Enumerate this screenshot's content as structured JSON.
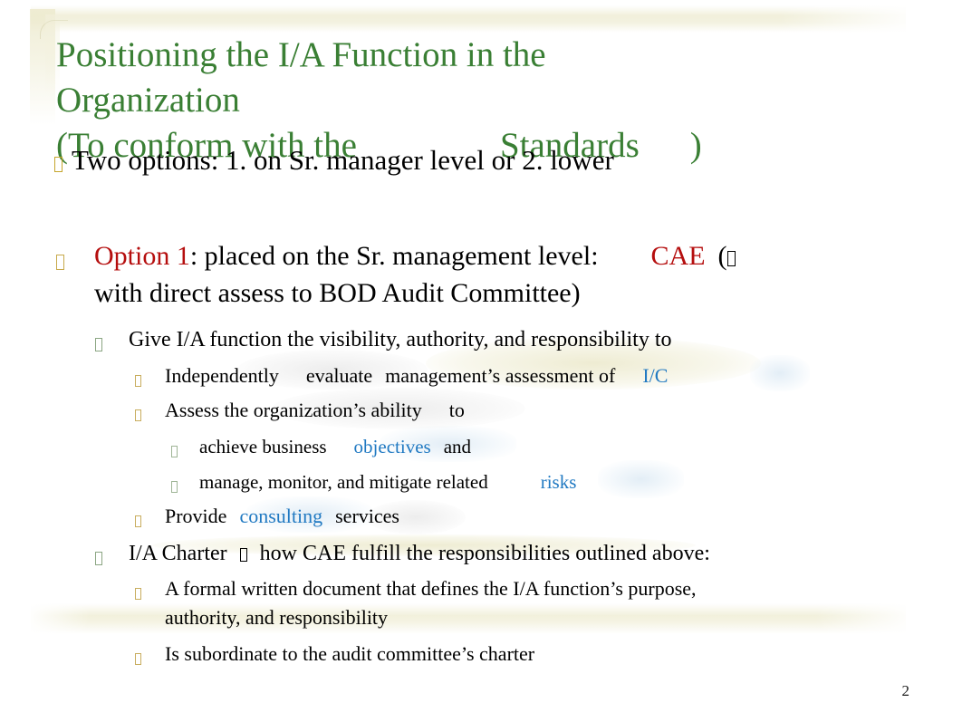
{
  "slide": {
    "page_number": "2",
    "colors": {
      "title_green": "#3a7f34",
      "accent_red": "#b50e0e",
      "accent_blue": "#2079c2",
      "band_beige": "#edeace",
      "bullet_gold": "#c7a94a",
      "bullet_green": "#8aa582"
    }
  },
  "title": {
    "line1": "Positioning the I/A Function in the",
    "line2": "Organization",
    "line3_prefix": "(To conform with the",
    "line3_standards": "Standards",
    "line3_suffix": ")"
  },
  "overlay": {
    "bullet_icon": "missing-glyph-box",
    "text": "Two options: 1. on Sr. manager level or 2. lower"
  },
  "body": {
    "option1": {
      "bullet_icon": "missing-glyph-box",
      "label": "Option 1",
      "text_a": ": placed on the Sr. management level:",
      "cae": "CAE",
      "paren_open": "(",
      "arrow_icon": "missing-glyph-box",
      "line2": "with direct assess to BOD Audit Committee)"
    },
    "give": {
      "bullet_icon": "missing-glyph-box",
      "text": "Give I/A function the visibility, authority, and responsibility to"
    },
    "independently": {
      "bullet_icon": "missing-glyph-box",
      "part1": "Independently",
      "part2": "evaluate",
      "part3": "management’s assessment of",
      "link": "I/C"
    },
    "assess": {
      "bullet_icon": "missing-glyph-box",
      "part1": "Assess the organization’s ability",
      "part2": "to"
    },
    "achieve": {
      "bullet_icon": "missing-glyph-box",
      "part1": "achieve business",
      "link": "objectives",
      "part2": "and"
    },
    "manage": {
      "bullet_icon": "missing-glyph-box",
      "part1": "manage, monitor, and mitigate related",
      "link": "risks"
    },
    "provide": {
      "bullet_icon": "missing-glyph-box",
      "part1": "Provide",
      "link": "consulting",
      "part2": "services"
    },
    "charter": {
      "bullet_icon": "missing-glyph-box",
      "part1": "I/A Charter",
      "arrow_icon": "missing-glyph-box",
      "part2": "how CAE fulfill the responsibilities outlined above:"
    },
    "formal_doc": {
      "bullet_icon": "missing-glyph-box",
      "line1": "A formal written document that defines the I/A function’s purpose,",
      "line2": "authority, and responsibility"
    },
    "subordinate": {
      "bullet_icon": "missing-glyph-box",
      "text": "Is subordinate to the audit committee’s charter"
    }
  }
}
